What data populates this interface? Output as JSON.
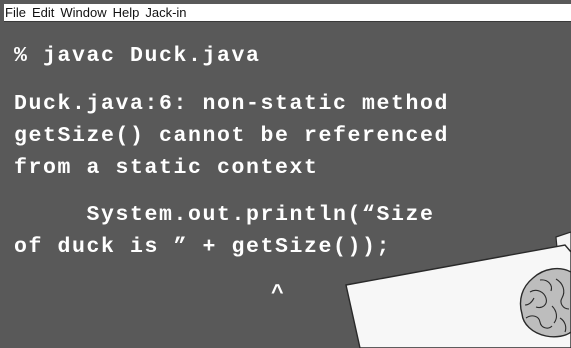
{
  "menubar": {
    "items": [
      "File",
      "Edit",
      "Window",
      "Help",
      "Jack-in"
    ]
  },
  "terminal": {
    "lines": [
      "% javac Duck.java",
      "Duck.java:6: non-static method",
      "getSize() cannot be referenced",
      "from a static context",
      "     System.out.println(“Size",
      "of duck is ” + getSize());"
    ],
    "caret": "^"
  },
  "colors": {
    "terminal_bg": "#595959",
    "terminal_text": "#ffffff",
    "menubar_bg": "#ffffff"
  }
}
